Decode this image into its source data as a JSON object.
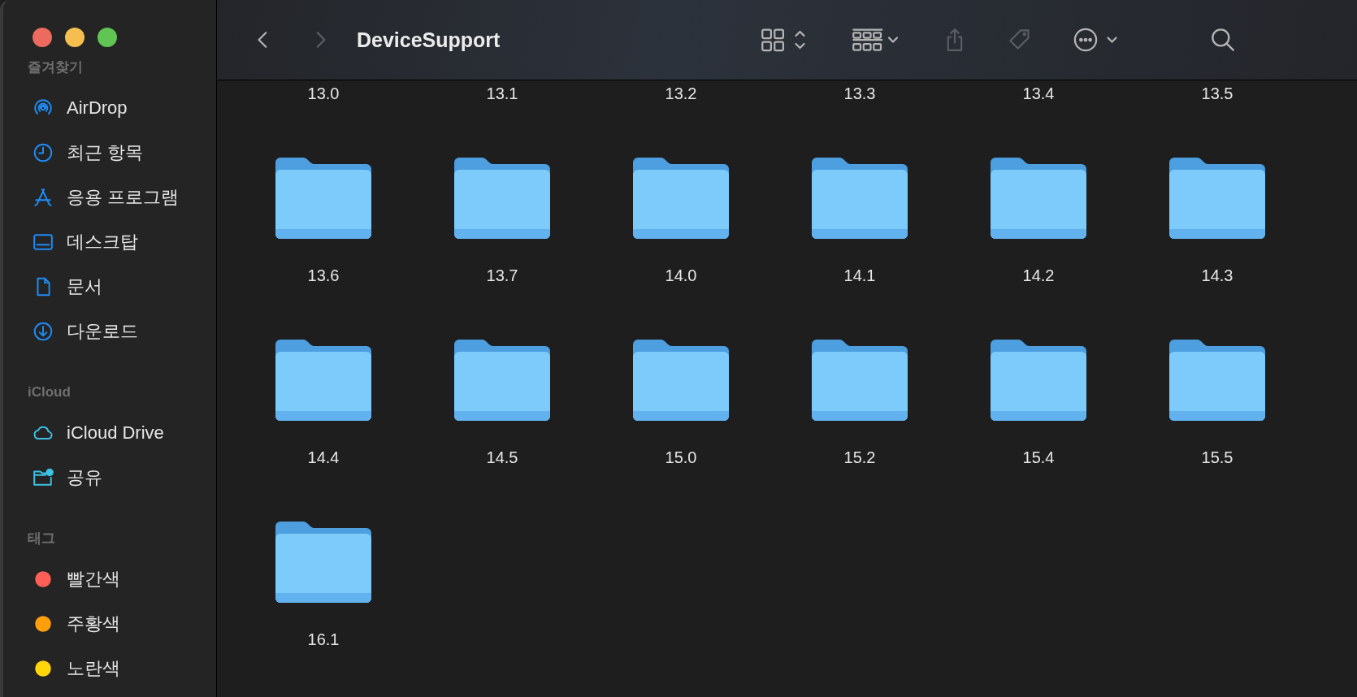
{
  "window": {
    "title": "DeviceSupport"
  },
  "toolbar": {
    "back": {
      "disabled": false
    },
    "forward": {
      "disabled": true
    },
    "buttons": [
      {
        "kind": "view",
        "disabled": false
      },
      {
        "kind": "group",
        "disabled": false
      },
      {
        "kind": "share",
        "disabled": true
      },
      {
        "kind": "tag",
        "disabled": true
      },
      {
        "kind": "more",
        "disabled": false
      },
      {
        "kind": "search",
        "disabled": false
      }
    ]
  },
  "sidebar": {
    "sections": [
      {
        "title": "즐겨찾기",
        "items": [
          {
            "label": "AirDrop",
            "kind": "airdrop"
          },
          {
            "label": "최근 항목",
            "kind": "recent"
          },
          {
            "label": "응용 프로그램",
            "kind": "apps"
          },
          {
            "label": "데스크탑",
            "kind": "desktop"
          },
          {
            "label": "문서",
            "kind": "document"
          },
          {
            "label": "다운로드",
            "kind": "download"
          }
        ]
      },
      {
        "title": "iCloud",
        "items": [
          {
            "label": "iCloud Drive",
            "kind": "cloud"
          },
          {
            "label": "공유",
            "kind": "shared"
          }
        ]
      },
      {
        "title": "태그",
        "items": [
          {
            "label": "빨간색",
            "kind": "tag",
            "color": "#ff5f57"
          },
          {
            "label": "주황색",
            "kind": "tag",
            "color": "#ff9f0a"
          },
          {
            "label": "노란색",
            "kind": "tag",
            "color": "#ffd60a"
          }
        ]
      }
    ]
  },
  "folders": [
    {
      "name": "13.0",
      "kind": "label"
    },
    {
      "name": "13.1",
      "kind": "label"
    },
    {
      "name": "13.2",
      "kind": "label"
    },
    {
      "name": "13.3",
      "kind": "label"
    },
    {
      "name": "13.4",
      "kind": "label"
    },
    {
      "name": "13.5",
      "kind": "label"
    },
    {
      "name": "13.6",
      "kind": "folder"
    },
    {
      "name": "13.7",
      "kind": "folder"
    },
    {
      "name": "14.0",
      "kind": "folder"
    },
    {
      "name": "14.1",
      "kind": "folder"
    },
    {
      "name": "14.2",
      "kind": "folder"
    },
    {
      "name": "14.3",
      "kind": "folder"
    },
    {
      "name": "14.4",
      "kind": "folder"
    },
    {
      "name": "14.5",
      "kind": "folder"
    },
    {
      "name": "15.0",
      "kind": "folder"
    },
    {
      "name": "15.2",
      "kind": "folder"
    },
    {
      "name": "15.4",
      "kind": "folder"
    },
    {
      "name": "15.5",
      "kind": "folder"
    },
    {
      "name": "16.1",
      "kind": "folder"
    }
  ]
}
